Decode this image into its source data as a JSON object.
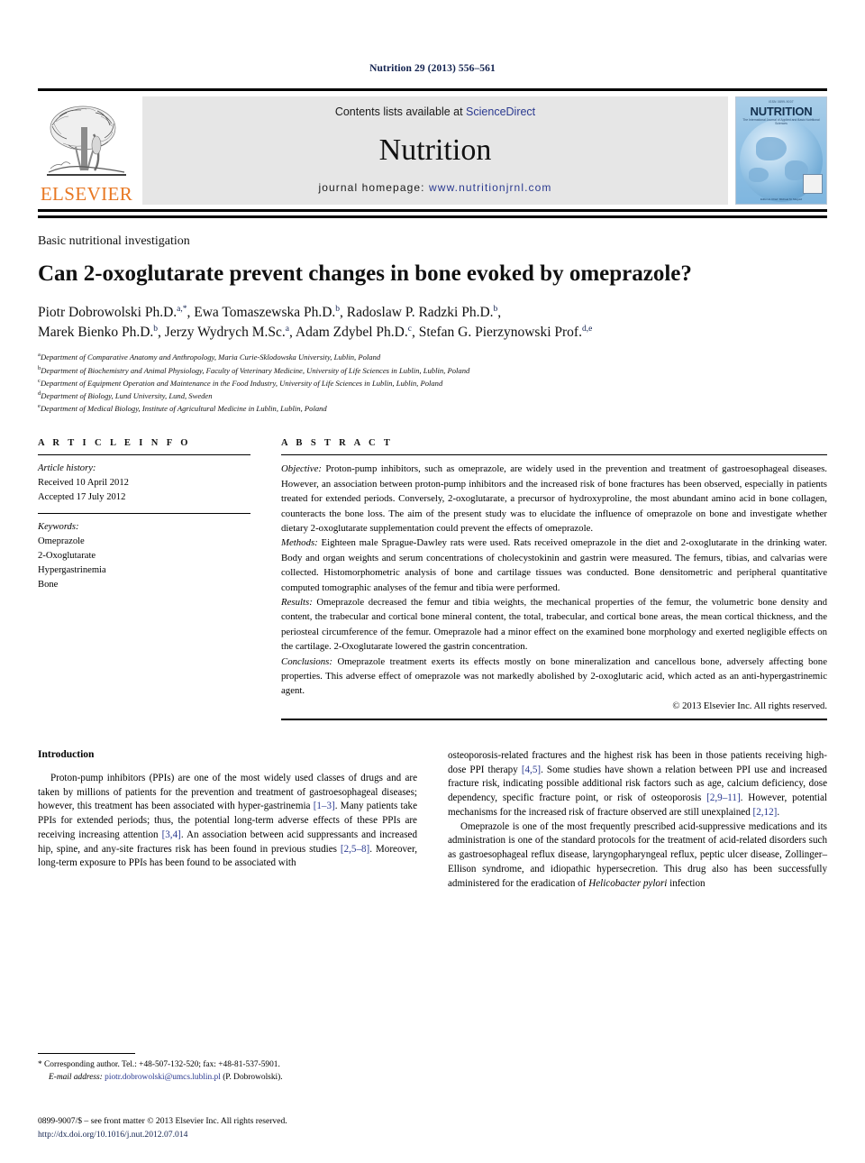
{
  "running_head": "Nutrition 29 (2013) 556–561",
  "masthead": {
    "publisher_name": "ELSEVIER",
    "contents_prefix": "Contents lists available at ",
    "contents_link": "ScienceDirect",
    "journal_title": "Nutrition",
    "homepage_prefix": "journal homepage: ",
    "homepage_url": "www.nutritionjrnl.com",
    "cover": {
      "top_tag": "ISSN 0899-9007",
      "title": "NUTRITION",
      "subtitle": "The International Journal of Applied and Basic Nutritional Sciences",
      "footer": "Editor-in-Chief: Michael M. Meguid"
    }
  },
  "article": {
    "section_type": "Basic nutritional investigation",
    "title": "Can 2-oxoglutarate prevent changes in bone evoked by omeprazole?",
    "authors_line_1": "Piotr Dobrowolski Ph.D.",
    "authors": [
      {
        "name": "Piotr Dobrowolski Ph.D.",
        "marks": "a,*"
      },
      {
        "name": "Ewa Tomaszewska Ph.D.",
        "marks": "b"
      },
      {
        "name": "Radoslaw P. Radzki Ph.D.",
        "marks": "b"
      },
      {
        "name": "Marek Bienko Ph.D.",
        "marks": "b"
      },
      {
        "name": "Jerzy Wydrych M.Sc.",
        "marks": "a"
      },
      {
        "name": "Adam Zdybel Ph.D.",
        "marks": "c"
      },
      {
        "name": "Stefan G. Pierzynowski Prof.",
        "marks": "d,e"
      }
    ],
    "affiliations": [
      {
        "mark": "a",
        "text": "Department of Comparative Anatomy and Anthropology, Maria Curie-Sklodowska University, Lublin, Poland"
      },
      {
        "mark": "b",
        "text": "Department of Biochemistry and Animal Physiology, Faculty of Veterinary Medicine, University of Life Sciences in Lublin, Lublin, Poland"
      },
      {
        "mark": "c",
        "text": "Department of Equipment Operation and Maintenance in the Food Industry, University of Life Sciences in Lublin, Lublin, Poland"
      },
      {
        "mark": "d",
        "text": "Department of Biology, Lund University, Lund, Sweden"
      },
      {
        "mark": "e",
        "text": "Department of Medical Biology, Institute of Agricultural Medicine in Lublin, Lublin, Poland"
      }
    ]
  },
  "article_info": {
    "heading": "A R T I C L E   I N F O",
    "history_label": "Article history:",
    "received": "Received 10 April 2012",
    "accepted": "Accepted 17 July 2012",
    "keywords_label": "Keywords:",
    "keywords": [
      "Omeprazole",
      "2-Oxoglutarate",
      "Hypergastrinemia",
      "Bone"
    ]
  },
  "abstract": {
    "heading": "A B S T R A C T",
    "objective_label": "Objective:",
    "objective_text": " Proton-pump inhibitors, such as omeprazole, are widely used in the prevention and treatment of gastroesophageal diseases. However, an association between proton-pump inhibitors and the increased risk of bone fractures has been observed, especially in patients treated for extended periods. Conversely, 2-oxoglutarate, a precursor of hydroxyproline, the most abundant amino acid in bone collagen, counteracts the bone loss. The aim of the present study was to elucidate the influence of omeprazole on bone and investigate whether dietary 2-oxoglutarate supplementation could prevent the effects of omeprazole.",
    "methods_label": "Methods:",
    "methods_text": " Eighteen male Sprague-Dawley rats were used. Rats received omeprazole in the diet and 2-oxoglutarate in the drinking water. Body and organ weights and serum concentrations of cholecystokinin and gastrin were measured. The femurs, tibias, and calvarias were collected. Histomorphometric analysis of bone and cartilage tissues was conducted. Bone densitometric and peripheral quantitative computed tomographic analyses of the femur and tibia were performed.",
    "results_label": "Results:",
    "results_text": " Omeprazole decreased the femur and tibia weights, the mechanical properties of the femur, the volumetric bone density and content, the trabecular and cortical bone mineral content, the total, trabecular, and cortical bone areas, the mean cortical thickness, and the periosteal circumference of the femur. Omeprazole had a minor effect on the examined bone morphology and exerted negligible effects on the cartilage. 2-Oxoglutarate lowered the gastrin concentration.",
    "conclusions_label": "Conclusions:",
    "conclusions_text": " Omeprazole treatment exerts its effects mostly on bone mineralization and cancellous bone, adversely affecting bone properties. This adverse effect of omeprazole was not markedly abolished by 2-oxoglutaric acid, which acted as an anti-hypergastrinemic agent.",
    "copyright": "© 2013 Elsevier Inc. All rights reserved."
  },
  "introduction": {
    "heading": "Introduction",
    "left_p1_a": "Proton-pump inhibitors (PPIs) are one of the most widely used classes of drugs and are taken by millions of patients for the prevention and treatment of gastroesophageal diseases; however, this treatment has been associated with hyper-gastrinemia ",
    "left_ref1": "[1–3]",
    "left_p1_b": ". Many patients take PPIs for extended periods; thus, the potential long-term adverse effects of these PPIs are receiving increasing attention ",
    "left_ref2": "[3,4]",
    "left_p1_c": ". An association between acid suppressants and increased hip, spine, and any-site fractures risk has been found in previous studies ",
    "left_ref3": "[2,5–8]",
    "left_p1_d": ". Moreover, long-term exposure to PPIs has been found to be associated with",
    "right_p1_a": "osteoporosis-related fractures and the highest risk has been in those patients receiving high-dose PPI therapy ",
    "right_ref1": "[4,5]",
    "right_p1_b": ". Some studies have shown a relation between PPI use and increased fracture risk, indicating possible additional risk factors such as age, calcium deficiency, dose dependency, specific fracture point, or risk of osteoporosis ",
    "right_ref2": "[2,9–11]",
    "right_p1_c": ". However, potential mechanisms for the increased risk of fracture observed are still unexplained ",
    "right_ref3": "[2,12]",
    "right_p1_d": ".",
    "right_p2_a": "Omeprazole is one of the most frequently prescribed acid-suppressive medications and its administration is one of the standard protocols for the treatment of acid-related disorders such as gastroesophageal reflux disease, laryngopharyngeal reflux, peptic ulcer disease, Zollinger–Ellison syndrome, and idiopathic hypersecretion. This drug also has been successfully administered for the eradication of ",
    "right_p2_italic": "Helicobacter pylori",
    "right_p2_b": " infection"
  },
  "footnote": {
    "star": "*",
    "corresponding": " Corresponding author. Tel.: +48-507-132-520; fax: +48-81-537-5901.",
    "email_label": "E-mail address:",
    "email": " piotr.dobrowolski@umcs.lublin.pl",
    "email_suffix": " (P. Dobrowolski)."
  },
  "page_footer": {
    "issn_line": "0899-9007/$ – see front matter © 2013 Elsevier Inc. All rights reserved.",
    "doi": "http://dx.doi.org/10.1016/j.nut.2012.07.014"
  },
  "colors": {
    "link_blue": "#2b3a90",
    "heading_navy": "#12224f",
    "elsevier_orange": "#e87722",
    "band_gray": "#e6e6e6",
    "cover_blue": "#8fc0e4"
  }
}
